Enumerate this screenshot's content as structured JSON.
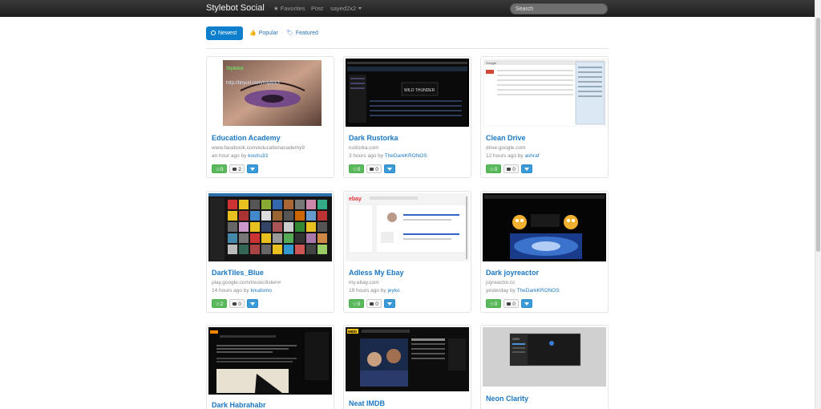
{
  "header": {
    "brand": "Stylebot Social",
    "favorites": "★ Favorites",
    "post": "Post",
    "user": "sayed2x2",
    "search_placeholder": "Search"
  },
  "tabs": {
    "newest": "Newest",
    "popular": "Popular",
    "featured": "Featured"
  },
  "styles": [
    {
      "title": "Education Academy",
      "url": "www.facebook.com/educationacademy9",
      "time": "an hour ago by",
      "author": "kostru33",
      "stars": "0",
      "comments": "2"
    },
    {
      "title": "Dark Rustorka",
      "url": "rustorka.com",
      "time": "3 hours ago by",
      "author": "TheDarkKRONOS",
      "stars": "0",
      "comments": "0"
    },
    {
      "title": "Clean Drive",
      "url": "drive.google.com",
      "time": "12 hours ago by",
      "author": "ashraf",
      "stars": "0",
      "comments": "0"
    },
    {
      "title": "DarkTiles_Blue",
      "url": "play.google.com/music/listen#",
      "time": "14 hours ago by",
      "author": "knudsmo",
      "stars": "2",
      "comments": "0"
    },
    {
      "title": "Adless My Ebay",
      "url": "my.ebay.com",
      "time": "19 hours ago by",
      "author": "jeyko",
      "stars": "0",
      "comments": "0"
    },
    {
      "title": "Dark joyreactor",
      "url": "joyreactor.cc",
      "time": "yesterday by",
      "author": "TheDarkKRONOS",
      "stars": "0",
      "comments": "0"
    },
    {
      "title": "Dark Habrahabr"
    },
    {
      "title": "Neat IMDB"
    },
    {
      "title": "Neon Clarity"
    }
  ],
  "thumb_text": {
    "url_overlay": "http://tinyurl.com/mly8rk3",
    "wild_thunder": "WILD THUNDER",
    "google": "Google",
    "ebay": "ebay",
    "imdb": "IMDb",
    "percent": "100%"
  }
}
